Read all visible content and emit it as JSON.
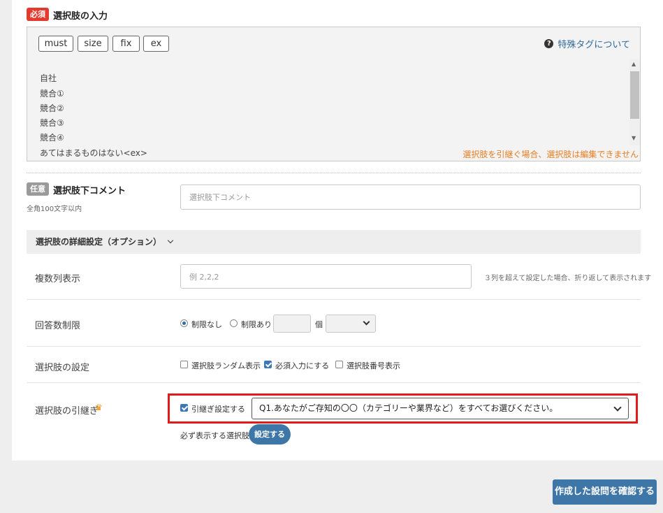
{
  "choices_section": {
    "required_badge": "必須",
    "title": "選択肢の入力",
    "tag_buttons": [
      "must",
      "size",
      "fix",
      "ex"
    ],
    "help_link": "特殊タグについて",
    "choices": [
      "自社",
      "競合①",
      "競合②",
      "競合③",
      "競合④",
      "あてはまるものはない<ex>"
    ],
    "warning": "選択肢を引継ぐ場合、選択肢は編集できません"
  },
  "comment_section": {
    "optional_badge": "任意",
    "title": "選択肢下コメント",
    "note": "全角100文字以内",
    "placeholder": "選択肢下コメント"
  },
  "details": {
    "section_title": "選択肢の詳細設定（オプション）",
    "columns": {
      "label": "複数列表示",
      "placeholder": "例 2,2,2",
      "note": "３列を超えて設定した場合、折り返して表示されます"
    },
    "answer_limit": {
      "label": "回答数制限",
      "no_limit": "制限なし",
      "with_limit": "制限あり",
      "unit": "個",
      "selected": "no_limit"
    },
    "choice_settings": {
      "label": "選択肢の設定",
      "random": "選択肢ランダム表示",
      "required": "必須入力にする",
      "numbering": "選択肢番号表示"
    },
    "inherit": {
      "label": "選択肢の引継ぎ",
      "checkbox_label": "引継ぎ設定する",
      "selected_question": "Q1.あなたがご存知の〇〇（カテゴリーや業界など）をすべてお選びください。",
      "must_show_label": "必ず表示する選択肢",
      "set_button": "設定する"
    }
  },
  "confirm_button": "作成した設問を確認する",
  "colors": {
    "accent": "#3f76a8",
    "required": "#e23a2e",
    "warning": "#e67e22",
    "highlight": "#e01b1b"
  }
}
